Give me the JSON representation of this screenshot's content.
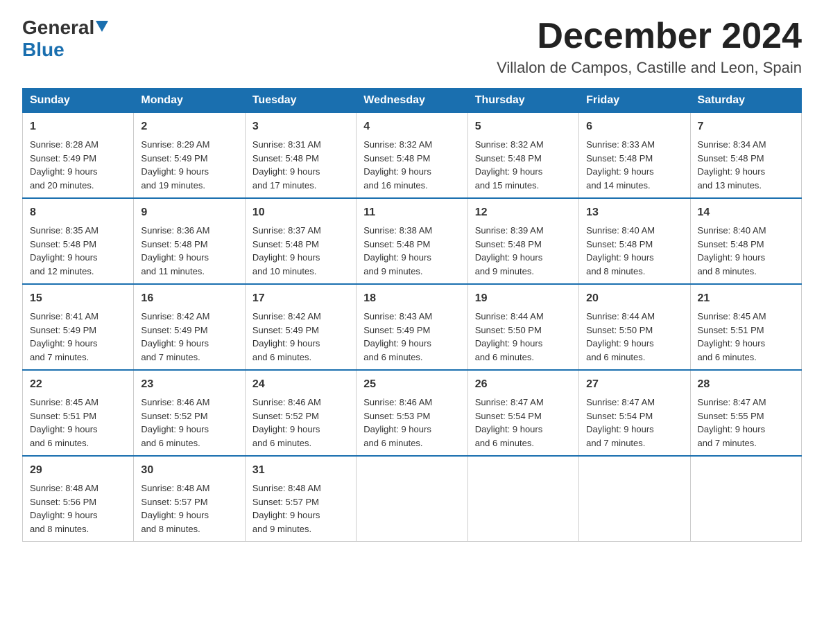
{
  "logo": {
    "general": "General",
    "blue": "Blue",
    "arrow": "▼"
  },
  "title": "December 2024",
  "subtitle": "Villalon de Campos, Castille and Leon, Spain",
  "weekdays": [
    "Sunday",
    "Monday",
    "Tuesday",
    "Wednesday",
    "Thursday",
    "Friday",
    "Saturday"
  ],
  "weeks": [
    [
      {
        "day": "1",
        "sunrise": "8:28 AM",
        "sunset": "5:49 PM",
        "daylight": "9 hours and 20 minutes."
      },
      {
        "day": "2",
        "sunrise": "8:29 AM",
        "sunset": "5:49 PM",
        "daylight": "9 hours and 19 minutes."
      },
      {
        "day": "3",
        "sunrise": "8:31 AM",
        "sunset": "5:48 PM",
        "daylight": "9 hours and 17 minutes."
      },
      {
        "day": "4",
        "sunrise": "8:32 AM",
        "sunset": "5:48 PM",
        "daylight": "9 hours and 16 minutes."
      },
      {
        "day": "5",
        "sunrise": "8:32 AM",
        "sunset": "5:48 PM",
        "daylight": "9 hours and 15 minutes."
      },
      {
        "day": "6",
        "sunrise": "8:33 AM",
        "sunset": "5:48 PM",
        "daylight": "9 hours and 14 minutes."
      },
      {
        "day": "7",
        "sunrise": "8:34 AM",
        "sunset": "5:48 PM",
        "daylight": "9 hours and 13 minutes."
      }
    ],
    [
      {
        "day": "8",
        "sunrise": "8:35 AM",
        "sunset": "5:48 PM",
        "daylight": "9 hours and 12 minutes."
      },
      {
        "day": "9",
        "sunrise": "8:36 AM",
        "sunset": "5:48 PM",
        "daylight": "9 hours and 11 minutes."
      },
      {
        "day": "10",
        "sunrise": "8:37 AM",
        "sunset": "5:48 PM",
        "daylight": "9 hours and 10 minutes."
      },
      {
        "day": "11",
        "sunrise": "8:38 AM",
        "sunset": "5:48 PM",
        "daylight": "9 hours and 9 minutes."
      },
      {
        "day": "12",
        "sunrise": "8:39 AM",
        "sunset": "5:48 PM",
        "daylight": "9 hours and 9 minutes."
      },
      {
        "day": "13",
        "sunrise": "8:40 AM",
        "sunset": "5:48 PM",
        "daylight": "9 hours and 8 minutes."
      },
      {
        "day": "14",
        "sunrise": "8:40 AM",
        "sunset": "5:48 PM",
        "daylight": "9 hours and 8 minutes."
      }
    ],
    [
      {
        "day": "15",
        "sunrise": "8:41 AM",
        "sunset": "5:49 PM",
        "daylight": "9 hours and 7 minutes."
      },
      {
        "day": "16",
        "sunrise": "8:42 AM",
        "sunset": "5:49 PM",
        "daylight": "9 hours and 7 minutes."
      },
      {
        "day": "17",
        "sunrise": "8:42 AM",
        "sunset": "5:49 PM",
        "daylight": "9 hours and 6 minutes."
      },
      {
        "day": "18",
        "sunrise": "8:43 AM",
        "sunset": "5:49 PM",
        "daylight": "9 hours and 6 minutes."
      },
      {
        "day": "19",
        "sunrise": "8:44 AM",
        "sunset": "5:50 PM",
        "daylight": "9 hours and 6 minutes."
      },
      {
        "day": "20",
        "sunrise": "8:44 AM",
        "sunset": "5:50 PM",
        "daylight": "9 hours and 6 minutes."
      },
      {
        "day": "21",
        "sunrise": "8:45 AM",
        "sunset": "5:51 PM",
        "daylight": "9 hours and 6 minutes."
      }
    ],
    [
      {
        "day": "22",
        "sunrise": "8:45 AM",
        "sunset": "5:51 PM",
        "daylight": "9 hours and 6 minutes."
      },
      {
        "day": "23",
        "sunrise": "8:46 AM",
        "sunset": "5:52 PM",
        "daylight": "9 hours and 6 minutes."
      },
      {
        "day": "24",
        "sunrise": "8:46 AM",
        "sunset": "5:52 PM",
        "daylight": "9 hours and 6 minutes."
      },
      {
        "day": "25",
        "sunrise": "8:46 AM",
        "sunset": "5:53 PM",
        "daylight": "9 hours and 6 minutes."
      },
      {
        "day": "26",
        "sunrise": "8:47 AM",
        "sunset": "5:54 PM",
        "daylight": "9 hours and 6 minutes."
      },
      {
        "day": "27",
        "sunrise": "8:47 AM",
        "sunset": "5:54 PM",
        "daylight": "9 hours and 7 minutes."
      },
      {
        "day": "28",
        "sunrise": "8:47 AM",
        "sunset": "5:55 PM",
        "daylight": "9 hours and 7 minutes."
      }
    ],
    [
      {
        "day": "29",
        "sunrise": "8:48 AM",
        "sunset": "5:56 PM",
        "daylight": "9 hours and 8 minutes."
      },
      {
        "day": "30",
        "sunrise": "8:48 AM",
        "sunset": "5:57 PM",
        "daylight": "9 hours and 8 minutes."
      },
      {
        "day": "31",
        "sunrise": "8:48 AM",
        "sunset": "5:57 PM",
        "daylight": "9 hours and 9 minutes."
      },
      null,
      null,
      null,
      null
    ]
  ],
  "labels": {
    "sunrise": "Sunrise:",
    "sunset": "Sunset:",
    "daylight": "Daylight:"
  }
}
